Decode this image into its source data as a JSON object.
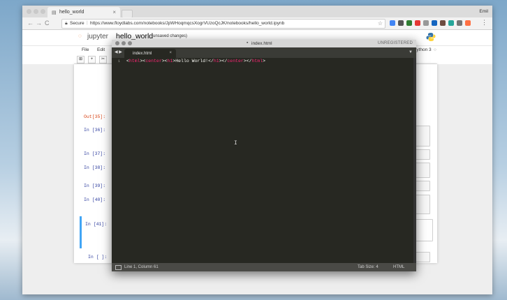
{
  "browser": {
    "tab_title": "hello_world",
    "tab_close": "×",
    "profile": "Emil",
    "secure_label": "Secure",
    "url": "https://www.floydlabs.com/notebooks/JpWHoqmqcsXogrVUzoQcJK/notebooks/hello_world.ipynb",
    "nav": {
      "back": "←",
      "forward": "→",
      "reload": "C"
    }
  },
  "jupyter": {
    "logo_word": "jupyter",
    "notebook_name": "hello_world",
    "save_status": "(unsaved changes)",
    "menus": [
      "File",
      "Edit"
    ],
    "kernel": "Python 3",
    "toolbar_buttons": [
      "⊞",
      "+",
      "✂"
    ],
    "cells": [
      {
        "prompt": "Out[35]:",
        "kind": "out"
      },
      {
        "prompt": "In [36]:",
        "kind": "in"
      },
      {
        "prompt": "In [37]:",
        "kind": "in"
      },
      {
        "prompt": "In [38]:",
        "kind": "in"
      },
      {
        "prompt": "In [39]:",
        "kind": "in"
      },
      {
        "prompt": "In [40]:",
        "kind": "in"
      },
      {
        "prompt": "In [41]:",
        "kind": "in",
        "selected": true
      },
      {
        "prompt": "In [ ]:",
        "kind": "in"
      }
    ]
  },
  "editor": {
    "window_title": "index.html",
    "license": "UNREGISTERED",
    "tab_name": "index.html",
    "tab_close": "×",
    "line_numbers": [
      "1"
    ],
    "code_parts": [
      {
        "text": "<",
        "cls": "txt"
      },
      {
        "text": "html",
        "cls": "tag"
      },
      {
        "text": "><",
        "cls": "txt"
      },
      {
        "text": "center",
        "cls": "tag"
      },
      {
        "text": "><",
        "cls": "txt"
      },
      {
        "text": "h1",
        "cls": "tag"
      },
      {
        "text": ">Hello World!</",
        "cls": "txt"
      },
      {
        "text": "h1",
        "cls": "tag"
      },
      {
        "text": "></",
        "cls": "txt"
      },
      {
        "text": "center",
        "cls": "tag"
      },
      {
        "text": "></",
        "cls": "txt"
      },
      {
        "text": "html",
        "cls": "tag"
      },
      {
        "text": ">",
        "cls": "txt"
      }
    ],
    "status": {
      "position": "Line 1, Column 61",
      "tab_size": "Tab Size: 4",
      "syntax": "HTML"
    }
  },
  "colors": {
    "accent_tag": "#f92672",
    "editor_bg": "#272822",
    "selection_bar": "#42a5f5"
  }
}
